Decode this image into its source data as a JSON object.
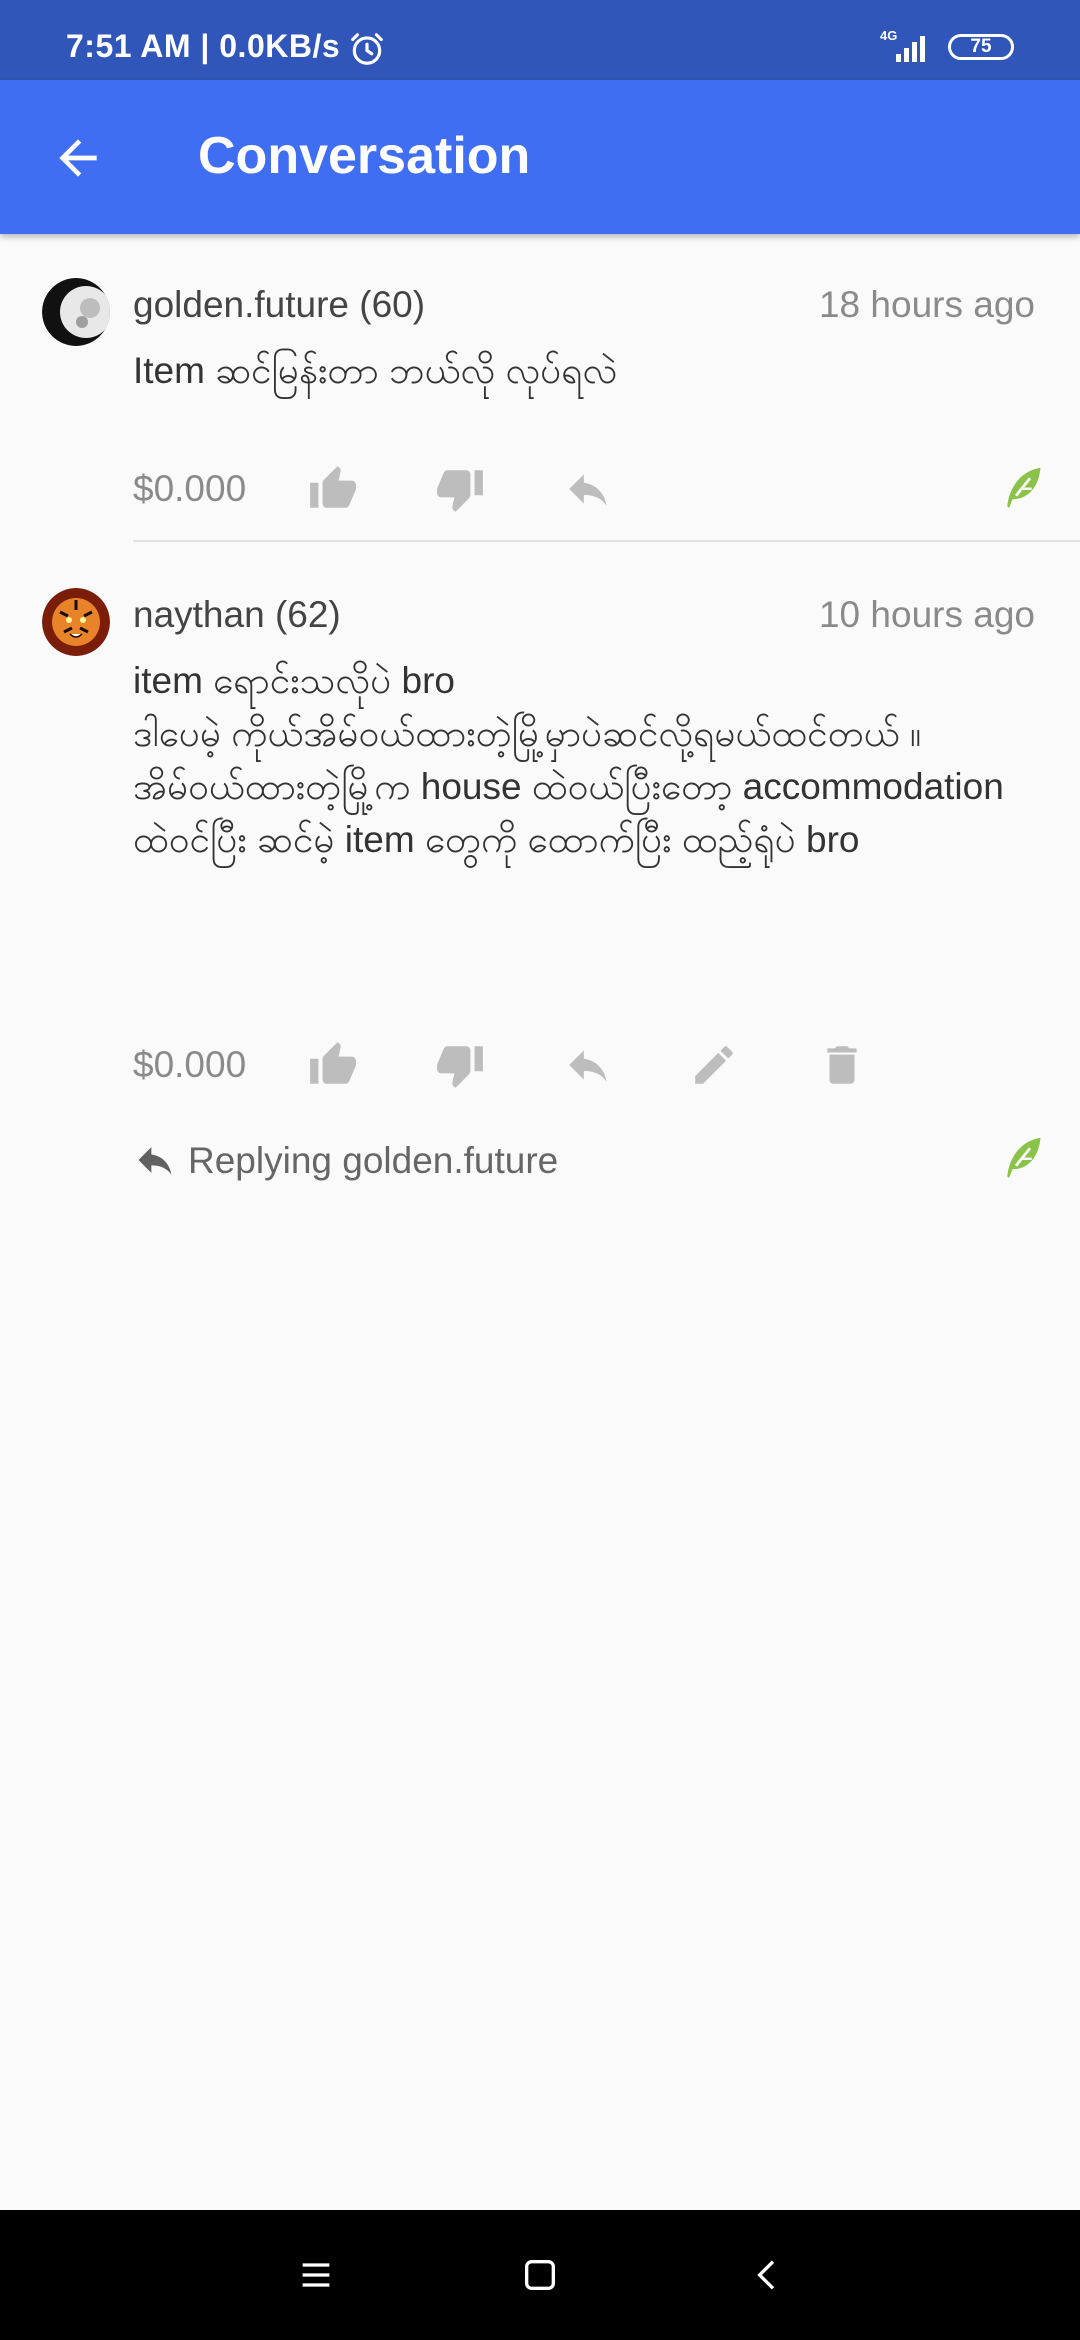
{
  "status_bar": {
    "time_speed": "7:51 AM | 0.0KB/s",
    "network": "4G",
    "battery": "75"
  },
  "app_bar": {
    "title": "Conversation",
    "back_icon": "arrow-back-icon"
  },
  "comments": [
    {
      "username": "golden.future (60)",
      "time": "18 hours ago",
      "body": "Item ဆင်မြန်းတာ ဘယ်လို လုပ်ရလဲ",
      "payout": "$0.000",
      "avatar_icon": "moon-avatar"
    },
    {
      "username": "naythan (62)",
      "time": "10 hours ago",
      "body": "item ရောင်းသလိုပဲ bro\nဒါပေမဲ့ ကိုယ်အိမ်ဝယ်ထားတဲ့မြို့မှာပဲဆင်လို့ရမယ်ထင်တယ် ။\nအိမ်ဝယ်ထားတဲ့မြို့က house ထဲဝယ်ပြီးတော့ accommodation ထဲဝင်ပြီး ဆင်မဲ့ item တွေကို  ထောက်ပြီး ထည့်ရုံပဲ bro",
      "payout": "$0.000",
      "avatar_icon": "tiger-avatar",
      "reply_to": "Replying golden.future"
    }
  ],
  "colors": {
    "app_bar": "#3f6ef2",
    "status_bar": "#2f56b8",
    "leaf_green": "#8bc34a",
    "icon_gray": "#bdbdbd"
  }
}
